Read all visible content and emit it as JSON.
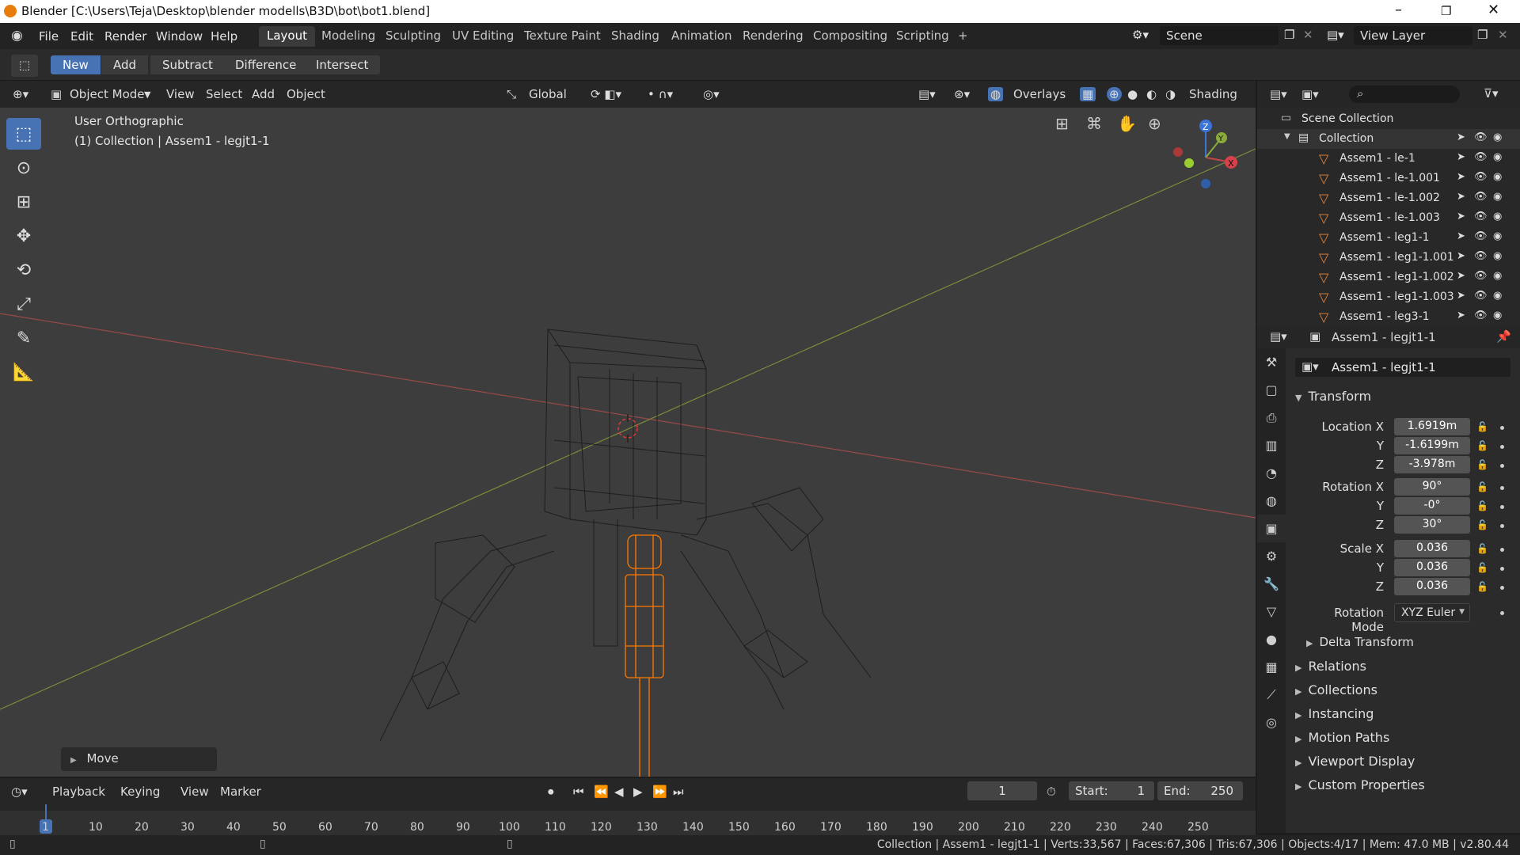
{
  "window": {
    "title": "Blender [C:\\Users\\Teja\\Desktop\\blender modells\\B3D\\bot\\bot1.blend]"
  },
  "menus": [
    "File",
    "Edit",
    "Render",
    "Window",
    "Help"
  ],
  "workspace_tabs": [
    "Layout",
    "Modeling",
    "Sculpting",
    "UV Editing",
    "Texture Paint",
    "Shading",
    "Animation",
    "Rendering",
    "Compositing",
    "Scripting",
    "+"
  ],
  "scene": {
    "name": "Scene",
    "view_layer": "View Layer"
  },
  "boolean_tools": [
    "New",
    "Add",
    "Subtract",
    "Difference",
    "Intersect"
  ],
  "viewport_header": {
    "mode": "Object Mode",
    "view": "View",
    "select": "Select",
    "add": "Add",
    "object": "Object",
    "transform": "Global",
    "overlays": "Overlays",
    "shading": "Shading"
  },
  "viewport": {
    "view_name": "User Orthographic",
    "context": "(1) Collection | Assem1 - legjt1-1",
    "last_op": "Move"
  },
  "gizmo": {
    "z": "Z",
    "y": "Y",
    "x": "X"
  },
  "outliner": {
    "root": "Scene Collection",
    "collection": "Collection",
    "items": [
      "Assem1 - le-1",
      "Assem1 - le-1.001",
      "Assem1 - le-1.002",
      "Assem1 - le-1.003",
      "Assem1 - leg1-1",
      "Assem1 - leg1-1.001",
      "Assem1 - leg1-1.002",
      "Assem1 - leg1-1.003",
      "Assem1 - leg3-1"
    ]
  },
  "properties": {
    "object_header": "Assem1 - legjt1-1",
    "object_name": "Assem1 - legjt1-1",
    "transform_label": "Transform",
    "location_label": "Location X",
    "location": {
      "x": "1.6919m",
      "y": "-1.6199m",
      "z": "-3.978m"
    },
    "rotation_label": "Rotation X",
    "rotation": {
      "x": "90°",
      "y": "-0°",
      "z": "30°"
    },
    "scale_label": "Scale X",
    "scale": {
      "x": "0.036",
      "y": "0.036",
      "z": "0.036"
    },
    "axis_y": "Y",
    "axis_z": "Z",
    "rotation_mode_label": "Rotation Mode",
    "rotation_mode": "XYZ Euler",
    "delta": "Delta Transform",
    "sections": [
      "Relations",
      "Collections",
      "Instancing",
      "Motion Paths",
      "Viewport Display",
      "Custom Properties"
    ]
  },
  "timeline": {
    "menus": [
      "Playback",
      "Keying",
      "View",
      "Marker"
    ],
    "current_frame": "1",
    "start_label": "Start:",
    "start": "1",
    "end_label": "End:",
    "end": "250",
    "ruler": [
      "1",
      "10",
      "20",
      "30",
      "40",
      "50",
      "60",
      "70",
      "80",
      "90",
      "100",
      "110",
      "120",
      "130",
      "140",
      "150",
      "160",
      "170",
      "180",
      "190",
      "200",
      "210",
      "220",
      "230",
      "240",
      "250"
    ]
  },
  "status": "Collection | Assem1 - legjt1-1 | Verts:33,567 | Faces:67,306 | Tris:67,306 | Objects:4/17 | Mem: 47.0 MB | v2.80.44",
  "colors": {
    "accent": "#4772b3",
    "selected_object": "#ff7a00",
    "x_axis": "#c04848",
    "y_axis": "#8aaa3a",
    "z_axis": "#3b75d8",
    "object_icon": "#e8843a"
  }
}
